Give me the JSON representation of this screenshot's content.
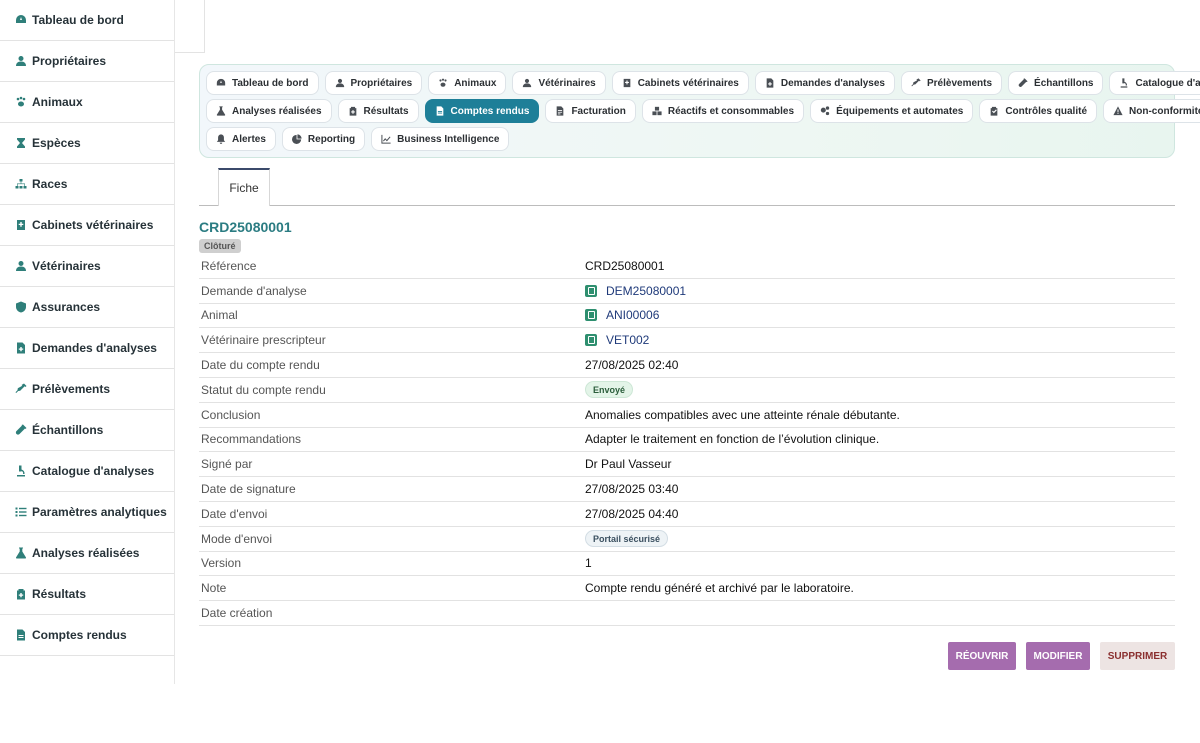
{
  "sidebar": {
    "items": [
      {
        "label": "Tableau de bord",
        "icon": "gauge-icon"
      },
      {
        "label": "Propriétaires",
        "icon": "user-icon"
      },
      {
        "label": "Animaux",
        "icon": "paw-icon"
      },
      {
        "label": "Espèces",
        "icon": "hourglass-icon"
      },
      {
        "label": "Races",
        "icon": "sitemap-icon"
      },
      {
        "label": "Cabinets vétérinaires",
        "icon": "clinic-icon"
      },
      {
        "label": "Vétérinaires",
        "icon": "doctor-icon"
      },
      {
        "label": "Assurances",
        "icon": "shield-icon"
      },
      {
        "label": "Demandes d'analyses",
        "icon": "file-medical-icon"
      },
      {
        "label": "Prélèvements",
        "icon": "syringe-icon"
      },
      {
        "label": "Échantillons",
        "icon": "vial-icon"
      },
      {
        "label": "Catalogue d'analyses",
        "icon": "microscope-icon"
      },
      {
        "label": "Paramètres analytiques",
        "icon": "list-icon"
      },
      {
        "label": "Analyses réalisées",
        "icon": "flask-icon"
      },
      {
        "label": "Résultats",
        "icon": "clipboard-icon"
      },
      {
        "label": "Comptes rendus",
        "icon": "report-icon"
      }
    ]
  },
  "nav": {
    "rows": [
      [
        {
          "label": "Tableau de bord",
          "icon": "gauge-icon"
        },
        {
          "label": "Propriétaires",
          "icon": "user-icon"
        },
        {
          "label": "Animaux",
          "icon": "paw-icon"
        },
        {
          "label": "Vétérinaires",
          "icon": "doctor-icon"
        },
        {
          "label": "Cabinets vétérinaires",
          "icon": "clinic-icon"
        },
        {
          "label": "Demandes d'analyses",
          "icon": "file-medical-icon"
        },
        {
          "label": "Prélèvements",
          "icon": "syringe-icon"
        },
        {
          "label": "Échantillons",
          "icon": "vial-icon"
        },
        {
          "label": "Catalogue d'analyses",
          "icon": "microscope-icon"
        }
      ],
      [
        {
          "label": "Analyses réalisées",
          "icon": "flask-icon"
        },
        {
          "label": "Résultats",
          "icon": "clipboard-icon"
        },
        {
          "label": "Comptes rendus",
          "icon": "report-icon",
          "active": true
        },
        {
          "label": "Facturation",
          "icon": "invoice-icon"
        },
        {
          "label": "Réactifs et consommables",
          "icon": "boxes-icon"
        },
        {
          "label": "Équipements et automates",
          "icon": "cogs-icon"
        },
        {
          "label": "Contrôles qualité",
          "icon": "clipboard-check-icon"
        },
        {
          "label": "Non-conformités",
          "icon": "warning-icon"
        }
      ],
      [
        {
          "label": "Alertes",
          "icon": "bell-icon"
        },
        {
          "label": "Reporting",
          "icon": "pie-icon"
        },
        {
          "label": "Business Intelligence",
          "icon": "chart-line-icon"
        }
      ]
    ]
  },
  "tabs": {
    "fiche": "Fiche"
  },
  "record": {
    "ref": "CRD25080001",
    "status_badge": "Clôturé",
    "fields": [
      {
        "label": "Référence",
        "value": "CRD25080001",
        "type": "text"
      },
      {
        "label": "Demande d'analyse",
        "value": "DEM25080001",
        "type": "link"
      },
      {
        "label": "Animal",
        "value": "ANI00006",
        "type": "link"
      },
      {
        "label": "Vétérinaire prescripteur",
        "value": "VET002",
        "type": "link"
      },
      {
        "label": "Date du compte rendu",
        "value": "27/08/2025 02:40",
        "type": "text"
      },
      {
        "label": "Statut du compte rendu",
        "value": "Envoyé",
        "type": "pill-green"
      },
      {
        "label": "Conclusion",
        "value": "Anomalies compatibles avec une atteinte rénale débutante.",
        "type": "text"
      },
      {
        "label": "Recommandations",
        "value": "Adapter le traitement en fonction de l’évolution clinique.",
        "type": "text"
      },
      {
        "label": "Signé par",
        "value": "Dr Paul Vasseur",
        "type": "text"
      },
      {
        "label": "Date de signature",
        "value": "27/08/2025 03:40",
        "type": "text"
      },
      {
        "label": "Date d'envoi",
        "value": "27/08/2025 04:40",
        "type": "text"
      },
      {
        "label": "Mode d'envoi",
        "value": "Portail sécurisé",
        "type": "pill-gray"
      },
      {
        "label": "Version",
        "value": "1",
        "type": "text"
      },
      {
        "label": "Note",
        "value": "Compte rendu généré et archivé par le laboratoire.",
        "type": "text"
      },
      {
        "label": "Date création",
        "value": "",
        "type": "text"
      }
    ]
  },
  "actions": {
    "reopen": "RÉOUVRIR",
    "edit": "MODIFIER",
    "delete": "SUPPRIMER"
  },
  "colors": {
    "accent": "#1e7f98",
    "teal_icon": "#2f7f7a",
    "title": "#2b7c82",
    "button_purple": "#a56cae"
  }
}
